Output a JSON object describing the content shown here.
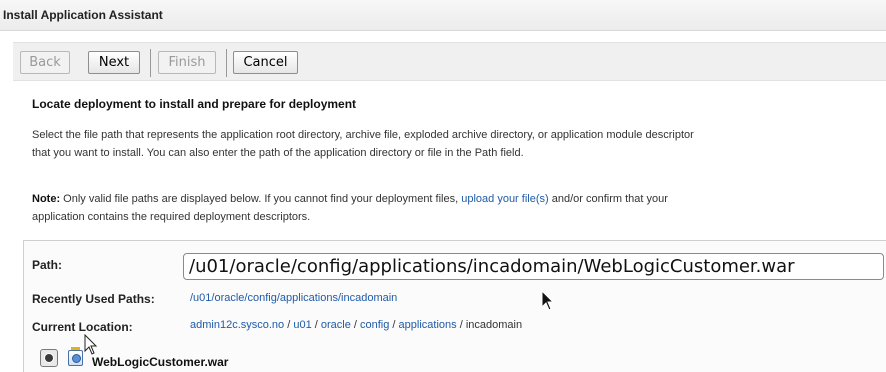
{
  "window": {
    "title": "Install Application Assistant"
  },
  "toolbar": {
    "back_label": "Back",
    "next_label": "Next",
    "finish_label": "Finish",
    "cancel_label": "Cancel"
  },
  "content": {
    "heading": "Locate deployment to install and prepare for deployment",
    "description_line1": "Select the file path that represents the application root directory, archive file, exploded archive directory, or application module descriptor",
    "description_line2": "that you want to install. You can also enter the path of the application directory or file in the Path field.",
    "note_label": "Note:",
    "note_text_before": " Only valid file paths are displayed below. If you cannot find your deployment files, ",
    "note_link": "upload your file(s)",
    "note_text_after": " and/or confirm that your",
    "note_line2": "application contains the required deployment descriptors."
  },
  "form": {
    "path_label": "Path:",
    "path_value": "/u01/oracle/config/applications/incadomain/WebLogicCustomer.war",
    "recent_label": "Recently Used Paths:",
    "recent_value": "/u01/oracle/config/applications/incadomain",
    "location_label": "Current Location:",
    "location_crumbs": [
      "admin12c.sysco.no",
      "u01",
      "oracle",
      "config",
      "applications"
    ],
    "location_current": "incadomain",
    "crumb_separator": " / "
  },
  "files": [
    {
      "name": "WebLogicCustomer.war",
      "selected": true
    }
  ],
  "icons": {
    "radio": "radio-selected-icon",
    "file": "archive-file-icon",
    "cursor": "mouse-pointer-icon"
  }
}
